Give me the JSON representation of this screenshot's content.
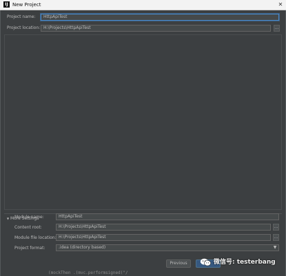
{
  "window": {
    "title": "New Project",
    "app_icon_letter": "IJ",
    "close_glyph": "✕"
  },
  "project": {
    "name_label": "Project name:",
    "name_value": "HttpApiTest",
    "location_label": "Project location:",
    "location_value": "H:\\Projects\\HttpApiTest",
    "browse_glyph": "..."
  },
  "more_settings": {
    "toggle_glyph": "▼",
    "label": "More Settings",
    "module_name_label": "Module name:",
    "module_name_value": "HttpApiTest",
    "content_root_label": "Content root:",
    "content_root_value": "H:\\Projects\\HttpApiTest",
    "module_file_location_label": "Module file location:",
    "module_file_location_value": "H:\\Projects\\HttpApiTest",
    "project_format_label": "Project format:",
    "project_format_value": ".idea (directory based)",
    "dropdown_glyph": "▼"
  },
  "buttons": {
    "previous": "Previous"
  },
  "watermark": {
    "text": "微信号: testerbang"
  },
  "background_text": "(mockThen .(mvc.performsigned(\"/"
}
